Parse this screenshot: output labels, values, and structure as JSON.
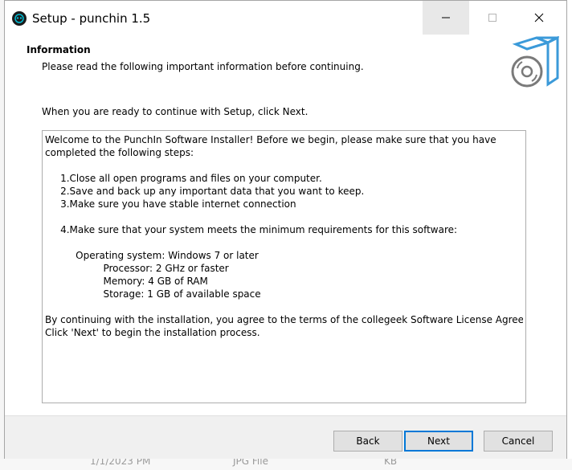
{
  "window": {
    "title": "Setup - punchin 1.5"
  },
  "header": {
    "title": "Information",
    "subtitle": "Please read the following important information before continuing."
  },
  "content": {
    "intro": "When you are ready to continue with Setup, click Next.",
    "memo_lines": [
      "Welcome to the PunchIn Software Installer! Before we begin, please make sure that you have",
      "completed the following steps:",
      "",
      "     1.Close all open programs and files on your computer.",
      "     2.Save and back up any important data that you want to keep.",
      "     3.Make sure you have stable internet connection",
      "",
      "     4.Make sure that your system meets the minimum requirements for this software:",
      "",
      "          Operating system: Windows 7 or later",
      "                   Processor: 2 GHz or faster",
      "                   Memory: 4 GB of RAM",
      "                   Storage: 1 GB of available space",
      "",
      "By continuing with the installation, you agree to the terms of the collegeek Software License Agreement.",
      "Click 'Next' to begin the installation process."
    ]
  },
  "buttons": {
    "back": "Back",
    "next": "Next",
    "cancel": "Cancel"
  },
  "background": {
    "date": "1/1/2023 PM",
    "type": "JPG File",
    "size": "KB"
  },
  "icons": {
    "app": "app-icon",
    "minimize": "minimize-icon",
    "maximize": "maximize-icon",
    "close": "close-icon",
    "logo": "installer-box-disc-icon"
  },
  "colors": {
    "accent": "#0078d7",
    "footer_bg": "#f0f0f0",
    "logo_blue": "#3b9ad9",
    "logo_gray": "#7a7a7a"
  }
}
